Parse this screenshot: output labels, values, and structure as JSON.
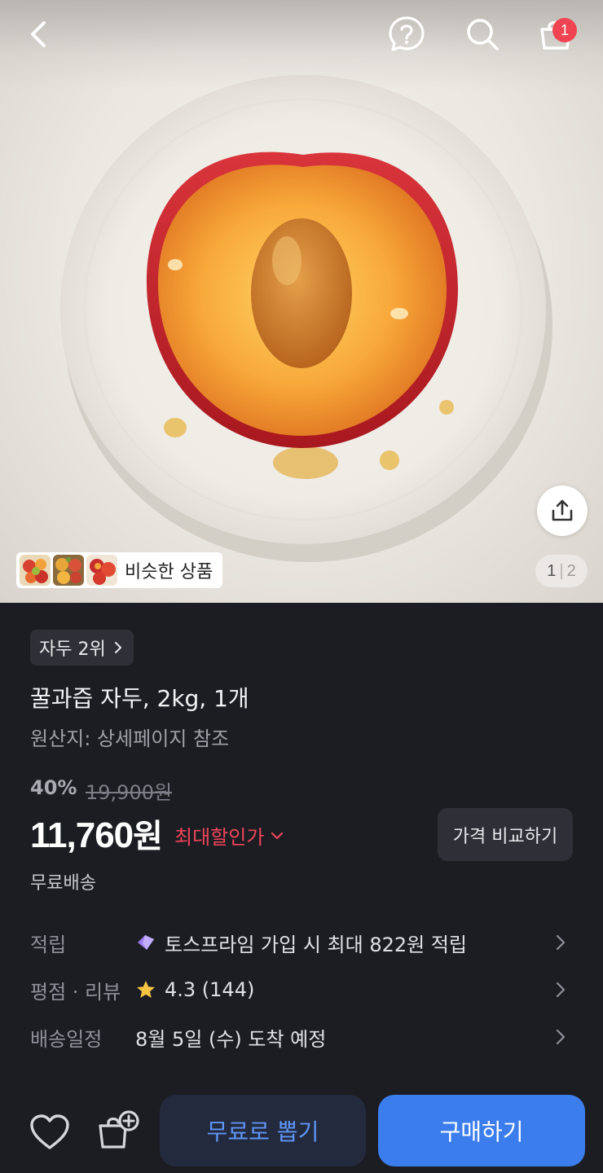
{
  "header": {
    "cart_count": "1",
    "icons": [
      "back-chevron-icon",
      "help-question-icon",
      "search-icon",
      "shopping-bag-icon"
    ]
  },
  "hero": {
    "image_counter": {
      "current": "1",
      "total": "2"
    },
    "similar_products_label": "비슷한 상품",
    "share_icon": "share-upload-icon"
  },
  "product": {
    "rank_label": "자두 2위",
    "title": "꿀과즙 자두, 2kg, 1개",
    "origin": "원산지: 상세페이지 참조",
    "discount_percent": "40%",
    "original_price": "19,900원",
    "price": "11,760",
    "price_unit": "원",
    "max_discount_label": "최대할인가",
    "compare_button": "가격 비교하기",
    "shipping_label": "무료배송"
  },
  "details": [
    {
      "label": "적립",
      "value": "토스프라임 가입 시 최대 822원 적립",
      "icon": "toss-prime-icon"
    },
    {
      "label": "평점 · 리뷰",
      "value": "4.3 (144)",
      "icon": "star-icon"
    },
    {
      "label": "배송일정",
      "value": "8월 5일 (수) 도착 예정",
      "icon": ""
    }
  ],
  "bottom_bar": {
    "free_pick_button": "무료로 뽑기",
    "buy_button": "구매하기",
    "icons": [
      "heart-icon",
      "add-to-cart-icon"
    ]
  },
  "colors": {
    "background": "#1c1d22",
    "accent_blue": "#3b7ded",
    "discount_red": "#f0445a",
    "badge_red": "#f04452"
  }
}
